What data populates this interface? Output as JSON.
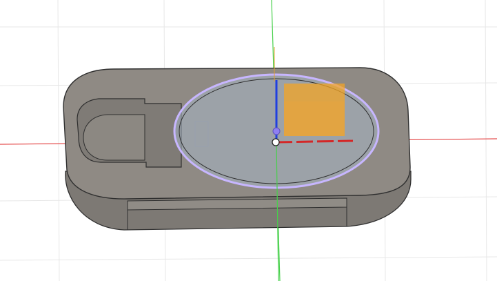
{
  "viewport": {
    "mode": "3d-model-view",
    "grid": true,
    "colors": {
      "background": "#ffffff",
      "grid_line": "#e7e7e7",
      "x_axis": "#e44848",
      "y_axis": "#46d04a",
      "z_axis": "#1f3fe0",
      "body_top": "#8f8a84",
      "body_side": "#7d7974",
      "body_edge": "#2f2f2f",
      "pocket_floor": "#a6a9ad",
      "sketch_profile": "#a7b7c7",
      "sketch_outline": "#c7b6ff",
      "highlight_box": "#f6a520"
    },
    "icons": [
      "origin-point-icon",
      "x-axis-icon",
      "y-axis-icon",
      "z-axis-icon",
      "selected-face-icon"
    ]
  }
}
